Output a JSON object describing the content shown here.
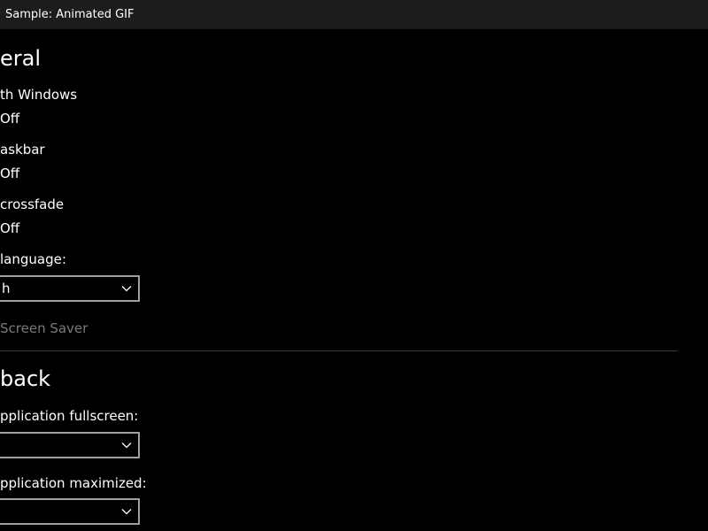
{
  "window": {
    "title": "Sample: Animated GIF"
  },
  "general": {
    "heading": "eral",
    "start_with_windows": {
      "label": "th Windows",
      "state": "Off"
    },
    "taskbar": {
      "label": "askbar",
      "state": "Off"
    },
    "crossfade": {
      "label": "crossfade",
      "state": "Off"
    },
    "language": {
      "label": " language:",
      "value": "h"
    },
    "screen_saver_link": "Screen Saver"
  },
  "playback": {
    "heading": "back",
    "fullscreen": {
      "label": "pplication fullscreen:",
      "value": ""
    },
    "maximized": {
      "label": "pplication maximized:",
      "value": ""
    }
  },
  "colors": {
    "background": "#000000",
    "titlebar": "#1c1c1c",
    "disabled_text": "#7a7a7a",
    "dropdown_border": "#a0a0a0",
    "divider": "#3a3a3a"
  },
  "icons": {
    "dropdown_chevron": "chevron-down-icon"
  }
}
